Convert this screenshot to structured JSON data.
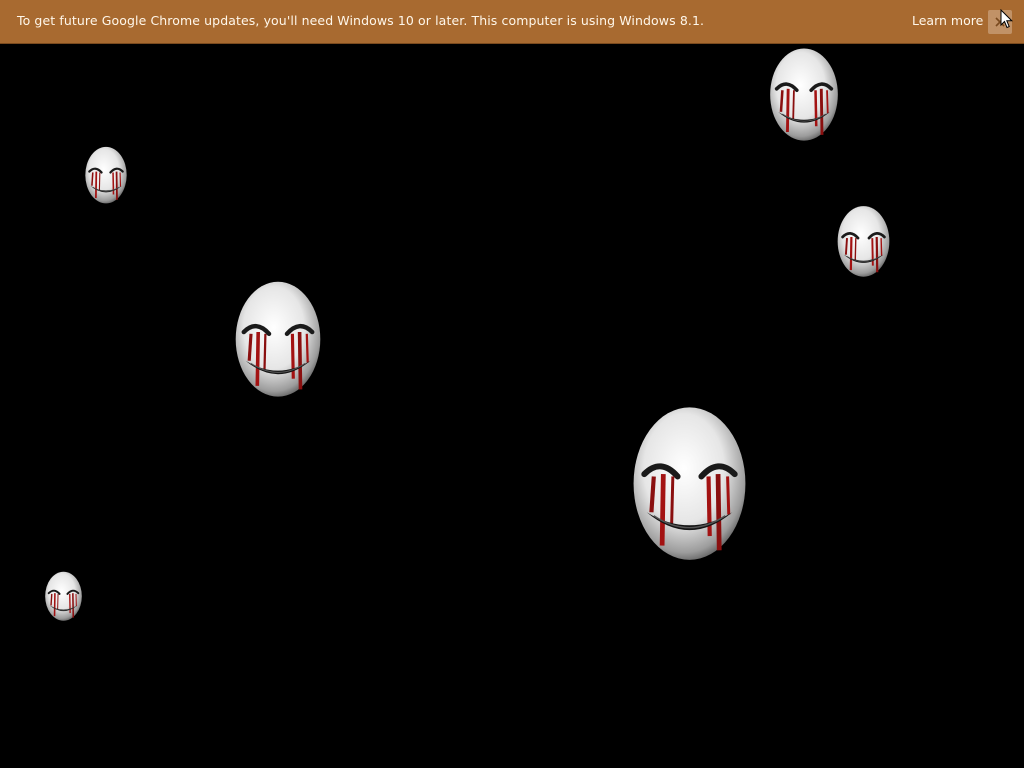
{
  "infobar": {
    "message": "To get future Google Chrome updates, you'll need Windows 10 or later. This computer is using Windows 8.1.",
    "learn_more_label": "Learn more",
    "close_icon": "close-icon",
    "background_color": "#a86a30"
  },
  "stage": {
    "background_color": "#000000",
    "mask_icon": "bleeding-smile-mask-icon",
    "mask_count": 6
  }
}
